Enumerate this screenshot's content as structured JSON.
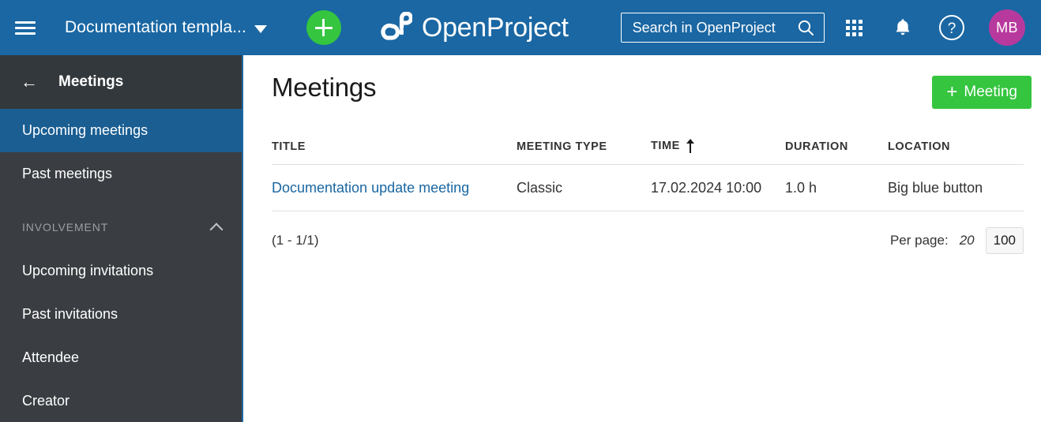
{
  "header": {
    "menu_icon": "hamburger-icon",
    "project_name": "Documentation templa...",
    "add_icon": "plus-icon",
    "brand_name": "OpenProject",
    "logo_icon": "openproject-logo-icon",
    "search": {
      "placeholder": "Search in OpenProject",
      "value": "",
      "icon": "search-icon"
    },
    "modules_icon": "grid-modules-icon",
    "notifications_icon": "bell-icon",
    "help_icon": "help-question-icon",
    "avatar_initials": "MB",
    "colors": {
      "header_bg": "#1A67A3",
      "add_button": "#35C53F",
      "avatar_bg": "#B8399E"
    }
  },
  "sidebar": {
    "back_icon": "arrow-left-icon",
    "title": "Meetings",
    "items": [
      {
        "label": "Upcoming meetings",
        "active": true
      },
      {
        "label": "Past meetings",
        "active": false
      }
    ],
    "section": {
      "label": "INVOLVEMENT",
      "collapse_icon": "chevron-up-icon",
      "items": [
        {
          "label": "Upcoming invitations"
        },
        {
          "label": "Past invitations"
        },
        {
          "label": "Attendee"
        },
        {
          "label": "Creator"
        }
      ]
    },
    "colors": {
      "bg": "#3A3E42",
      "active_bg": "#1A5E92"
    }
  },
  "main": {
    "page_title": "Meetings",
    "new_meeting_button": {
      "label": "Meeting",
      "icon": "plus-icon",
      "color": "#35C53F"
    },
    "table": {
      "columns": [
        {
          "label": "TITLE",
          "sorted": false
        },
        {
          "label": "MEETING TYPE",
          "sorted": false
        },
        {
          "label": "TIME",
          "sorted": true,
          "sort_icon": "sort-ascending-arrow-icon"
        },
        {
          "label": "DURATION",
          "sorted": false
        },
        {
          "label": "LOCATION",
          "sorted": false
        }
      ],
      "rows": [
        {
          "title": "Documentation update meeting",
          "meeting_type": "Classic",
          "time": "17.02.2024 10:00",
          "duration": "1.0 h",
          "location": "Big blue button"
        }
      ]
    },
    "pagination": {
      "count": "(1 - 1/1)",
      "per_page_label": "Per page:",
      "options": [
        {
          "label": "20",
          "current": false
        },
        {
          "label": "100",
          "current": true
        }
      ]
    }
  }
}
